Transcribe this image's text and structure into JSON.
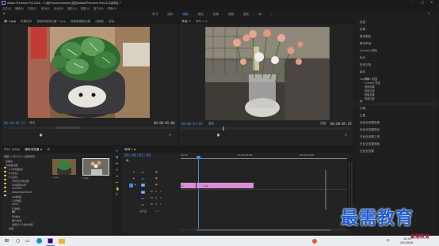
{
  "titlebar": {
    "title": "Adobe Premiere Pro 2020 - C:\\用户\\Administrator\\文档\\Adobe\\Premiere Pro\\14.0\\未命名 *"
  },
  "menu": [
    "文件(F)",
    "编辑(E)",
    "剪辑(C)",
    "序列(S)",
    "标记(M)",
    "图形(G)",
    "视图(V)",
    "窗口(W)",
    "帮助(H)"
  ],
  "workspaces": [
    "学习",
    "组件",
    "编辑",
    "颜色",
    "效果",
    "音频",
    "图形",
    "库",
    "»"
  ],
  "source": {
    "tabs": [
      "源: 1.jpg",
      "效果控件",
      "音频剪辑混合器: 1.jpg",
      "音频剪辑混合器",
      "元数据",
      "旧版..."
    ],
    "timecode_left": "00:00:03:12",
    "fit": "适合",
    "timecode_right": "00:00:05:00"
  },
  "program": {
    "tabs": [
      "节目: 1",
      "序列 1 ≡"
    ],
    "timecode_left": "00:00:01:08",
    "fit": "适合",
    "ratio": "完整",
    "timecode_right": "00:00:05:19"
  },
  "right_panel": {
    "items": [
      "信息",
      "效果",
      "基本图形",
      "基本声音",
      "Lumetri 颜色",
      "标记",
      "历史记录",
      "事件",
      "Lumetri 范围",
      "预设",
      "Lumetri 预设",
      "音频效果",
      "音频过渡",
      "视频效果",
      "视频过渡",
      "库",
      "字幕",
      "主要",
      "在此处放置效果",
      "在此处放置预设",
      "在此处放置工具",
      "在此处放置面板",
      "在此处放置"
    ]
  },
  "project": {
    "tabs": [
      "项目: 未命名",
      "媒体浏览器 ≡",
      "库"
    ],
    "path": "电脑 > Win10 > 桌面资源",
    "tree": [
      "收藏夹",
      "本地驱动器",
      "C:(本地磁盘)",
      "D:(软件)",
      "E:(资料)",
      "360安全浏览器",
      "360驱动大师",
      "ACDSee",
      "AdobeDownload",
      "cad教程",
      "CS6教程",
      "office",
      "PS教程",
      "PR",
      "PR素材",
      "图片素材",
      "视频(101)素材视频",
      "桌面",
      "文档"
    ],
    "thumbnails": [
      {
        "label": "1.jpg"
      },
      {
        "label": "2.jpg"
      }
    ]
  },
  "timeline": {
    "tab": "序列 1 ≡",
    "timecode": "00:00:01:08",
    "ruler": [
      "00:00",
      "00:00:05:00",
      "00:00:10:00"
    ],
    "tracks": [
      "V3",
      "V2",
      "V1",
      "A1",
      "A2",
      "A3",
      "主声道"
    ],
    "master_value": "0.0",
    "clip1_label": "1.jpg",
    "clip2_label": "fx"
  },
  "watermark": {
    "main": "最需教育",
    "corner": "最需教育"
  },
  "taskbar": {
    "time": "10:25",
    "date": "2021/6/26",
    "lang": "中"
  }
}
